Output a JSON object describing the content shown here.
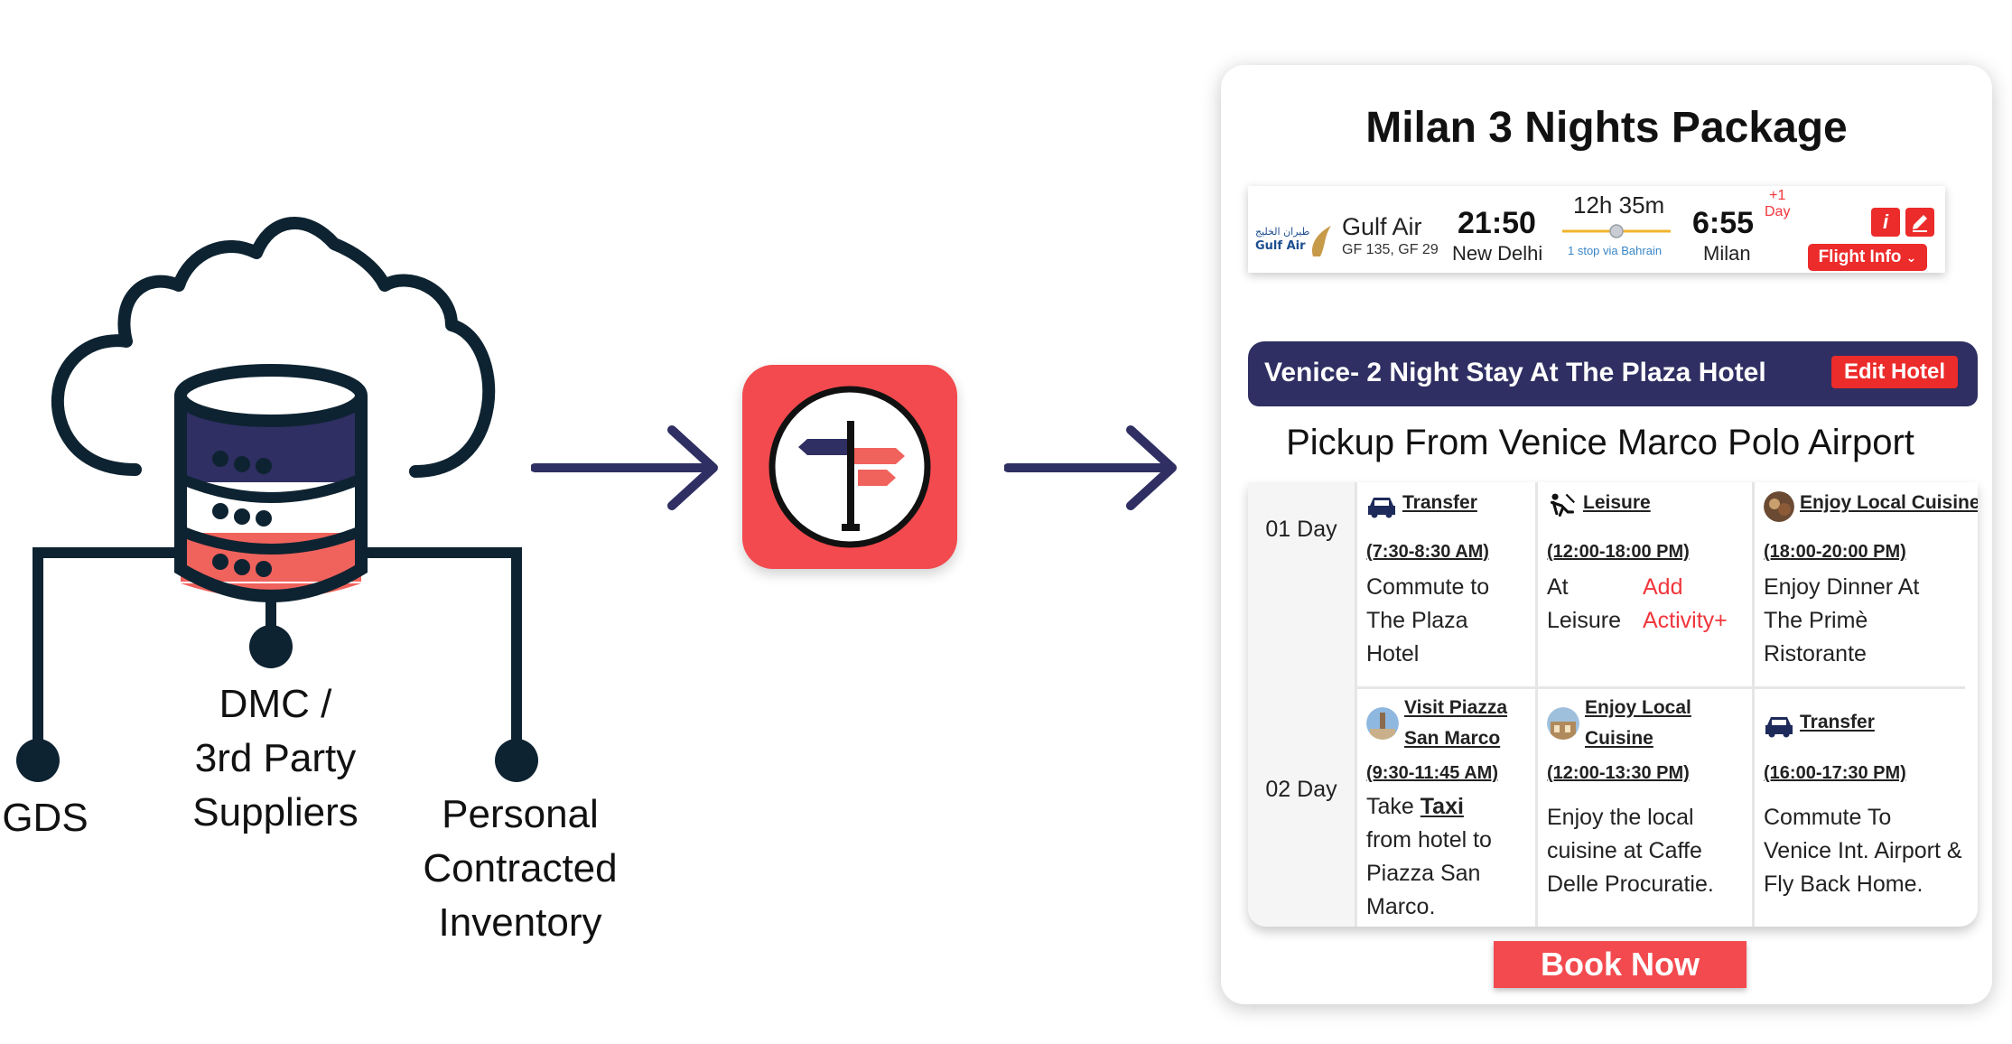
{
  "sources": {
    "gds": "GDS",
    "dmc": [
      "DMC /",
      "3rd Party",
      "Suppliers"
    ],
    "personal": [
      "Personal",
      "Contracted",
      "Inventory"
    ]
  },
  "colors": {
    "brand_red": "#f24a4e",
    "navy": "#2f2f63",
    "action_red": "#ec2b2b"
  },
  "package": {
    "title": "Milan 3 Nights Package",
    "flight": {
      "airline_logo_text": [
        "طيران الخليج",
        "Gulf Air"
      ],
      "airline": "Gulf Air",
      "codes": "GF 135, GF 29",
      "departure_time": "21:50",
      "departure_city": "New Delhi",
      "duration": "12h 35m",
      "stops": "1 stop via Bahrain",
      "arrival_time": "6:55",
      "arrival_city": "Milan",
      "day_offset": [
        "+1",
        "Day"
      ],
      "info_icon": "info-icon",
      "edit_icon": "pencil-icon",
      "info_button": "Flight Info"
    },
    "hotel": {
      "title": "Venice- 2 Night Stay At The Plaza Hotel",
      "edit_button": "Edit Hotel"
    },
    "pickup": "Pickup From Venice Marco Polo Airport",
    "days": [
      {
        "label": "01 Day",
        "activities": [
          {
            "icon": "car-icon",
            "title": "Transfer",
            "time": "(7:30-8:30 AM)",
            "desc": [
              "Commute to",
              "The Plaza",
              "Hotel"
            ]
          },
          {
            "icon": "relax-icon",
            "title": "Leisure",
            "time": "(12:00-18:00 PM)",
            "desc": [
              "At",
              "Leisure"
            ],
            "extra": [
              "Add",
              "Activity+"
            ]
          },
          {
            "icon": "food-photo",
            "title": "Enjoy Local Cuisine",
            "time": "(18:00-20:00 PM)",
            "desc": [
              "Enjoy Dinner At",
              "The Primè",
              "Ristorante"
            ]
          }
        ]
      },
      {
        "label": "02 Day",
        "activities": [
          {
            "icon": "piazza-photo",
            "title": [
              "Visit Piazza",
              "San Marco"
            ],
            "time": "(9:30-11:45 AM)",
            "desc_prefix": "Take ",
            "desc_link": "Taxi",
            "desc": [
              "from hotel to",
              "Piazza San",
              "Marco."
            ]
          },
          {
            "icon": "cuisine-photo",
            "title": [
              "Enjoy Local",
              "Cuisine"
            ],
            "time": "(12:00-13:30 PM)",
            "desc": [
              "Enjoy the local",
              "cuisine at Caffe",
              "Delle Procuratie."
            ]
          },
          {
            "icon": "car-icon",
            "title": "Transfer",
            "time": "(16:00-17:30 PM)",
            "desc": [
              "Commute To",
              "Venice Int. Airport &",
              "Fly Back Home."
            ]
          }
        ]
      }
    ],
    "book_button": "Book Now"
  }
}
